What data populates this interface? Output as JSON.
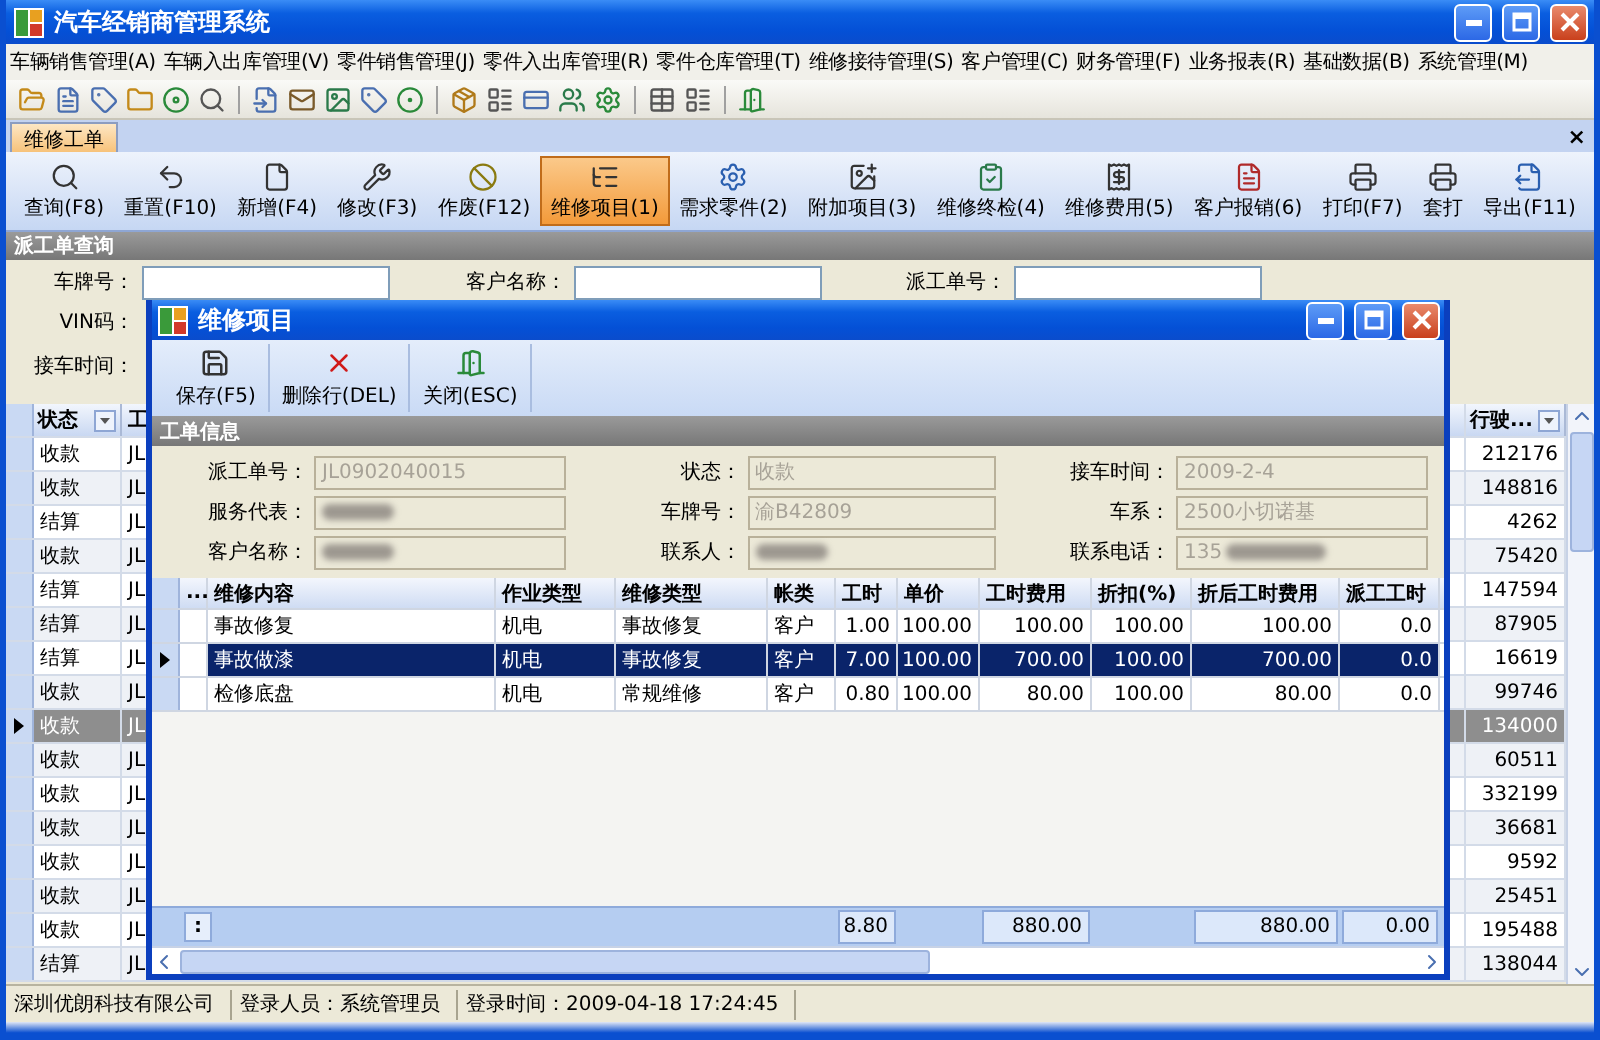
{
  "window": {
    "title": "汽车经销商管理系统"
  },
  "menu": [
    "车辆销售管理(A)",
    "车辆入出库管理(V)",
    "零件销售管理(J)",
    "零件入出库管理(R)",
    "零件仓库管理(T)",
    "维修接待管理(S)",
    "客户管理(C)",
    "财务管理(F)",
    "业务报表(R)",
    "基础数据(B)",
    "系统管理(M)"
  ],
  "document_tab": {
    "label": "维修工单",
    "selected": true,
    "close": "×"
  },
  "toolbar": [
    {
      "label": "查询(F8)",
      "selected": false
    },
    {
      "label": "重置(F10)",
      "selected": false
    },
    {
      "label": "新增(F4)",
      "selected": false
    },
    {
      "label": "修改(F3)",
      "selected": false
    },
    {
      "label": "作废(F12)",
      "selected": false
    },
    {
      "label": "维修项目(1)",
      "selected": true
    },
    {
      "label": "需求零件(2)",
      "selected": false
    },
    {
      "label": "附加项目(3)",
      "selected": false
    },
    {
      "label": "维修终检(4)",
      "selected": false
    },
    {
      "label": "维修费用(5)",
      "selected": false
    },
    {
      "label": "客户报销(6)",
      "selected": false
    },
    {
      "label": "打印(F7)",
      "selected": false
    },
    {
      "label": "套打",
      "selected": false
    },
    {
      "label": "导出(F11)",
      "selected": false
    }
  ],
  "query_panel": {
    "title": "派工单查询",
    "plate_label": "车牌号：",
    "customer_label": "客户名称：",
    "order_label": "派工单号：",
    "vin_label": "VIN码：",
    "date_label": "接车时间："
  },
  "orders_table": {
    "columns": [
      "状态",
      "工",
      "行驶..."
    ],
    "rows": [
      {
        "status": "收款",
        "column_2": "JL",
        "mileage": "212176",
        "selected": false
      },
      {
        "status": "收款",
        "column_2": "JL",
        "mileage": "148816",
        "selected": false
      },
      {
        "status": "结算",
        "column_2": "JL",
        "mileage": "4262",
        "selected": false
      },
      {
        "status": "收款",
        "column_2": "JL",
        "mileage": "75420",
        "selected": false
      },
      {
        "status": "结算",
        "column_2": "JL",
        "mileage": "147594",
        "selected": false
      },
      {
        "status": "结算",
        "column_2": "JL",
        "mileage": "87905",
        "selected": false
      },
      {
        "status": "结算",
        "column_2": "JL",
        "mileage": "16619",
        "selected": false
      },
      {
        "status": "收款",
        "column_2": "JL",
        "mileage": "99746",
        "selected": false
      },
      {
        "status": "收款",
        "column_2": "JL",
        "mileage": "134000",
        "selected": true
      },
      {
        "status": "收款",
        "column_2": "JL",
        "mileage": "60511",
        "selected": false
      },
      {
        "status": "收款",
        "column_2": "JL",
        "mileage": "332199",
        "selected": false
      },
      {
        "status": "收款",
        "column_2": "JL",
        "mileage": "36681",
        "selected": false
      },
      {
        "status": "收款",
        "column_2": "JL",
        "mileage": "9592",
        "selected": false
      },
      {
        "status": "收款",
        "column_2": "JL",
        "mileage": "25451",
        "selected": false
      },
      {
        "status": "收款",
        "column_2": "JL",
        "mileage": "195488",
        "selected": false
      },
      {
        "status": "结算",
        "column_2": "JL",
        "mileage": "138044",
        "selected": false
      }
    ]
  },
  "status_bar": [
    "深圳优朗科技有限公司",
    "登录人员：系统管理员",
    "登录时间：2009-04-18 17:24:45"
  ],
  "dialog": {
    "title": "维修项目",
    "toolbar": [
      "保存(F5)",
      "删除行(DEL)",
      "关闭(ESC)"
    ],
    "section": "工单信息",
    "fields": [
      {
        "label": "派工单号：",
        "kind": "text",
        "value": "JL0902040015"
      },
      {
        "label": "状态：",
        "kind": "text",
        "value": "收款"
      },
      {
        "label": "接车时间：",
        "kind": "text",
        "value": "2009-2-4"
      },
      {
        "label": "服务代表：",
        "kind": "redacted"
      },
      {
        "label": "车牌号：",
        "kind": "text",
        "value": "渝B42809"
      },
      {
        "label": "车系：",
        "kind": "text",
        "value": "2500小切诺基"
      },
      {
        "label": "客户名称：",
        "kind": "redacted"
      },
      {
        "label": "联系人：",
        "kind": "redacted"
      },
      {
        "label": "联系电话：",
        "kind": "partial",
        "value": "135"
      }
    ],
    "grid": {
      "marker_header": "...",
      "columns": [
        "维修内容",
        "作业类型",
        "维修类型",
        "帐类",
        "工时",
        "单价",
        "工时费用",
        "折扣(%)",
        "折后工时费用",
        "派工工时"
      ],
      "rows": [
        {
          "selected": false,
          "cells": [
            "事故修复",
            "机电",
            "事故修复",
            "客户",
            "1.00",
            "100.00",
            "100.00",
            "100.00",
            "100.00",
            "0.0"
          ]
        },
        {
          "selected": true,
          "cells": [
            "事故做漆",
            "机电",
            "事故修复",
            "客户",
            "7.00",
            "100.00",
            "700.00",
            "100.00",
            "700.00",
            "0.0"
          ]
        },
        {
          "selected": false,
          "cells": [
            "检修底盘",
            "机电",
            "常规维修",
            "客户",
            "0.80",
            "100.00",
            "80.00",
            "100.00",
            "80.00",
            "0.0"
          ]
        }
      ],
      "totals": {
        "marker": ":",
        "hours": "8.80",
        "labor_fee": "880.00",
        "net_fee": "880.00",
        "dispatch_hours": "0.00"
      }
    }
  }
}
